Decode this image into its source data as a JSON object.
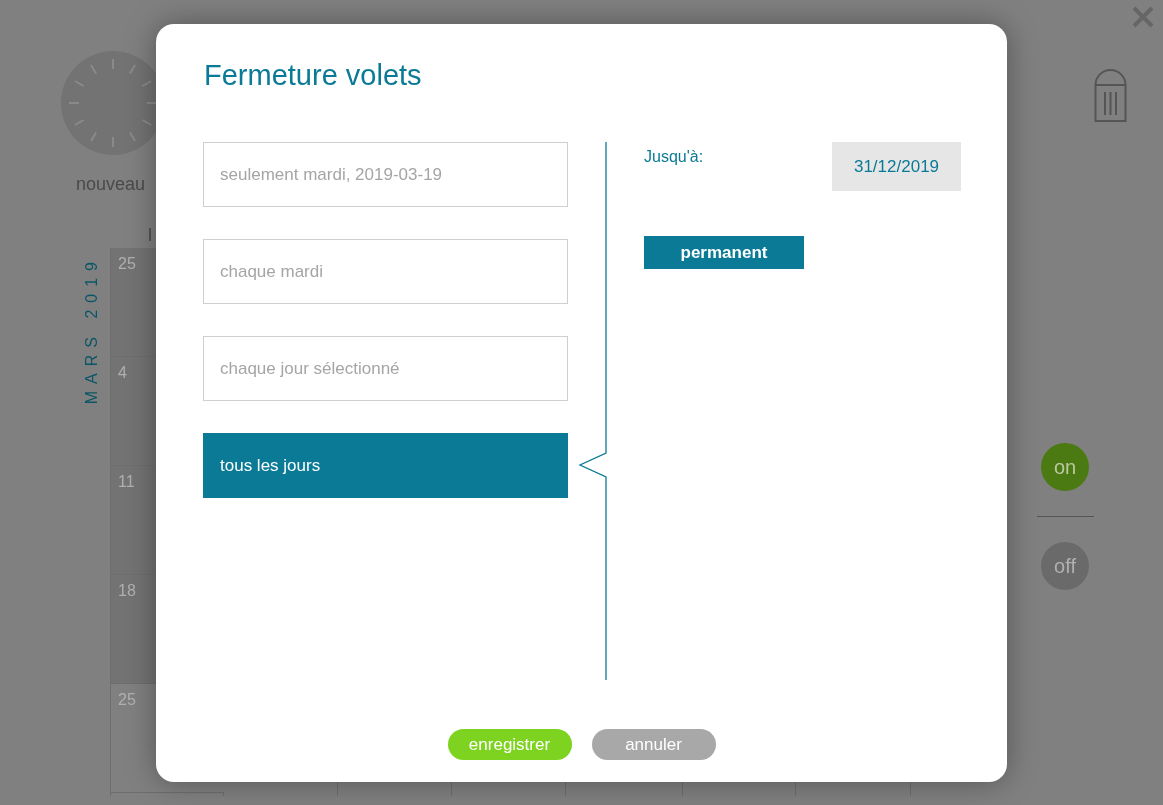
{
  "background": {
    "new_label": "nouveau",
    "weekday_label": "l",
    "month_label": "MARS 2019",
    "calendar_days": [
      {
        "label": "25",
        "kind": "past"
      },
      {
        "label": "4",
        "kind": "past"
      },
      {
        "label": "11",
        "kind": "past"
      },
      {
        "label": "18",
        "kind": "past"
      },
      {
        "label": "25",
        "kind": "future"
      }
    ],
    "switches": [
      {
        "label": "on",
        "selected": true
      },
      {
        "label": "off",
        "selected": false
      }
    ]
  },
  "dialog": {
    "title": "Fermeture volets",
    "options": [
      {
        "label": "seulement mardi, 2019-03-19",
        "selected": false
      },
      {
        "label": "chaque mardi",
        "selected": false
      },
      {
        "label": "chaque jour sélectionné",
        "selected": false
      },
      {
        "label": "tous les jours",
        "selected": true
      }
    ],
    "until_label": "Jusqu'à:",
    "until_date": "31/12/2019",
    "permanent_button": "permanent",
    "buttons": [
      {
        "label": "enregistrer",
        "kind": "primary"
      },
      {
        "label": "annuler",
        "kind": "secondary"
      }
    ]
  }
}
